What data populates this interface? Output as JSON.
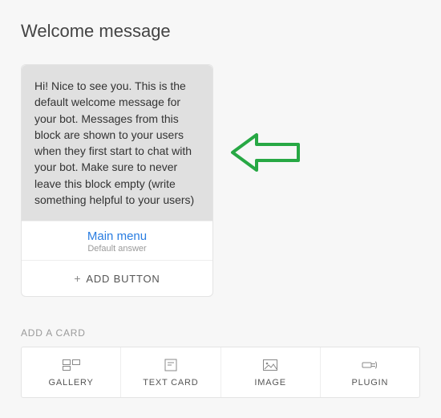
{
  "page_title": "Welcome message",
  "welcome_card": {
    "text": "Hi! Nice to see you. This is the default welcome message for your bot. Messages from this block are shown to your users when they first start to chat with your bot. Make sure to never leave this block empty (write something helpful to your users)",
    "menu_link": "Main menu",
    "menu_sub": "Default answer",
    "add_button_label": "ADD BUTTON"
  },
  "add_card": {
    "section_label": "ADD A CARD",
    "options": {
      "gallery": "GALLERY",
      "text_card": "TEXT CARD",
      "image": "IMAGE",
      "plugin": "PLUGIN"
    }
  },
  "annotation": {
    "arrow_color": "#27a844"
  }
}
